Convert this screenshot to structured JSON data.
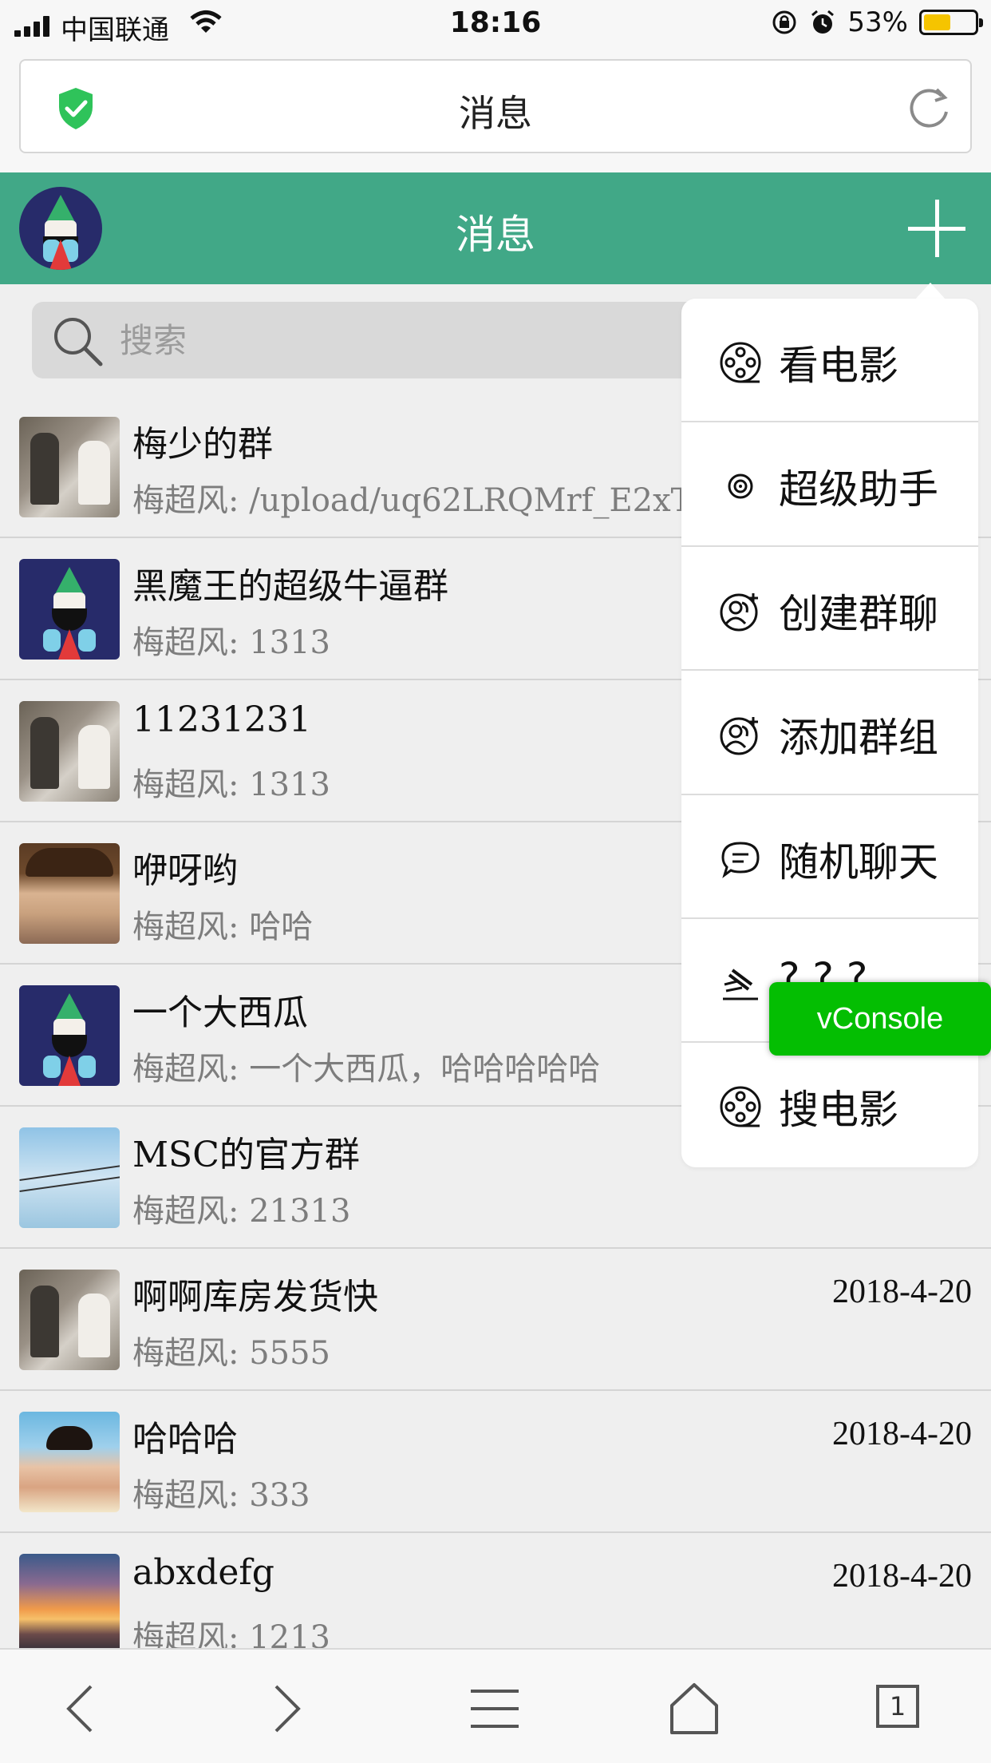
{
  "status_bar": {
    "carrier": "中国联通",
    "time": "18:16",
    "battery_percent": "53%",
    "battery_level": 0.53,
    "icons": [
      "signal-icon",
      "wifi-icon",
      "rotation-lock-icon",
      "alarm-icon",
      "battery-icon"
    ]
  },
  "browser": {
    "page_title": "消息",
    "secure_icon": "shield-check-icon",
    "reload_icon": "reload-icon",
    "tab_count": "1"
  },
  "header": {
    "title": "消息",
    "add_icon": "plus-icon"
  },
  "search": {
    "placeholder": "搜索"
  },
  "chats": [
    {
      "name": "梅少的群",
      "preview": "梅超风: /upload/uq62LRQMrf_E2xTl",
      "date": "",
      "avatar": "office"
    },
    {
      "name": "黑魔王的超级牛逼群",
      "preview": "梅超风: 1313",
      "date": "",
      "avatar": "wizard"
    },
    {
      "name": "11231231",
      "preview": "梅超风: 1313",
      "date": "",
      "avatar": "office"
    },
    {
      "name": "咿呀哟",
      "preview": "梅超风: 哈哈",
      "date": "",
      "avatar": "boy"
    },
    {
      "name": "一个大西瓜",
      "preview": "梅超风: 一个大西瓜，哈哈哈哈哈",
      "date": "",
      "avatar": "wizard"
    },
    {
      "name": "MSC的官方群",
      "preview": "梅超风: 21313",
      "date": "",
      "avatar": "sky"
    },
    {
      "name": "啊啊库房发货快",
      "preview": "梅超风: 5555",
      "date": "2018-4-20",
      "avatar": "office"
    },
    {
      "name": "哈哈哈",
      "preview": "梅超风: 333",
      "date": "2018-4-20",
      "avatar": "girl"
    },
    {
      "name": "abxdefg",
      "preview": "梅超风: 1213",
      "date": "2018-4-20",
      "avatar": "sunset"
    }
  ],
  "menu": {
    "items": [
      {
        "label": "看电影",
        "icon": "film-reel-icon"
      },
      {
        "label": "超级助手",
        "icon": "target-icon"
      },
      {
        "label": "创建群聊",
        "icon": "group-add-icon"
      },
      {
        "label": "添加群组",
        "icon": "group-add-icon"
      },
      {
        "label": "随机聊天",
        "icon": "chat-bubble-icon"
      },
      {
        "label": "? ? ?",
        "icon": "gavel-icon"
      },
      {
        "label": "搜电影",
        "icon": "film-reel-icon"
      }
    ]
  },
  "vconsole": {
    "label": "vConsole"
  },
  "toolbar": {
    "icons": [
      "back-icon",
      "forward-icon",
      "menu-icon",
      "home-icon",
      "tabs-icon"
    ]
  },
  "colors": {
    "header_green": "#41a887",
    "vconsole_green": "#04be02",
    "list_background": "#efefef"
  }
}
